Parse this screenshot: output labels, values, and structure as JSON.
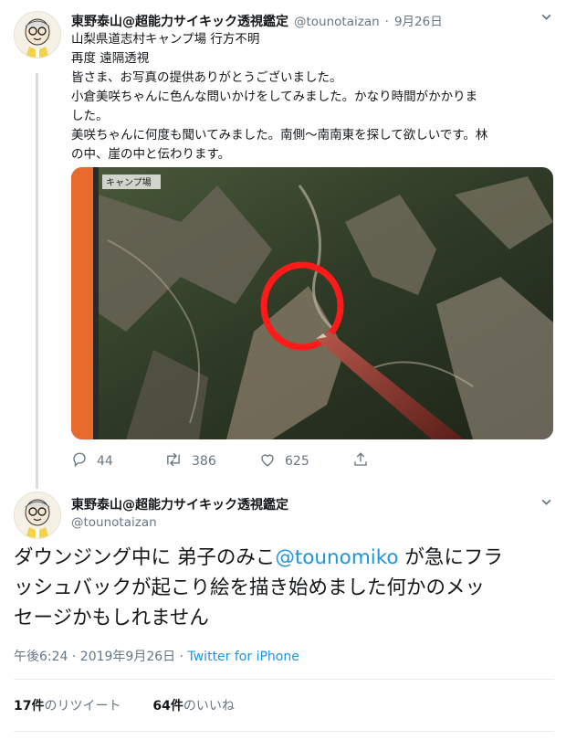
{
  "tweet1": {
    "name": "東野泰山@超能力サイキック透視鑑定",
    "handle": "@tounotaizan",
    "sep": "·",
    "date": "9月26日",
    "lines": [
      "山梨県道志村キャンプ場 行方不明",
      "再度 遠隔透視",
      "皆さま、お写真の提供ありがとうございました。",
      "小倉美咲ちゃんに色んな問いかけをしてみました。かなり時間がかかりま",
      "した。",
      "美咲ちゃんに何度も聞いてみました。南側〜南南東を探して欲しいです。林",
      "の中、崖の中と伝わります。"
    ],
    "map_label": "キャンプ場",
    "replies": "44",
    "retweets": "386",
    "likes": "625"
  },
  "tweet2": {
    "name": "東野泰山@超能力サイキック透視鑑定",
    "handle": "@tounotaizan",
    "text_a": "ダウンジング中に 弟子のみこ",
    "mention": "@tounomiko",
    "text_b": " が急にフラ",
    "line2": "ッシュバックが起こり絵を描き始めました何かのメッ",
    "line3": "セージかもしれません",
    "time": "午後6:24 · 2019年9月26日",
    "meta_sep": " · ",
    "source": "Twitter for iPhone",
    "retweet_count": "17件",
    "retweet_label": "のリツイート",
    "like_count": "64件",
    "like_label": "のいいね"
  },
  "colors": {
    "accent": "#1b95e0",
    "muted": "#657786",
    "annotation": "#ff1a1a"
  },
  "icons": [
    "reply-icon",
    "retweet-icon",
    "like-icon",
    "share-icon",
    "chevron-down-icon"
  ]
}
